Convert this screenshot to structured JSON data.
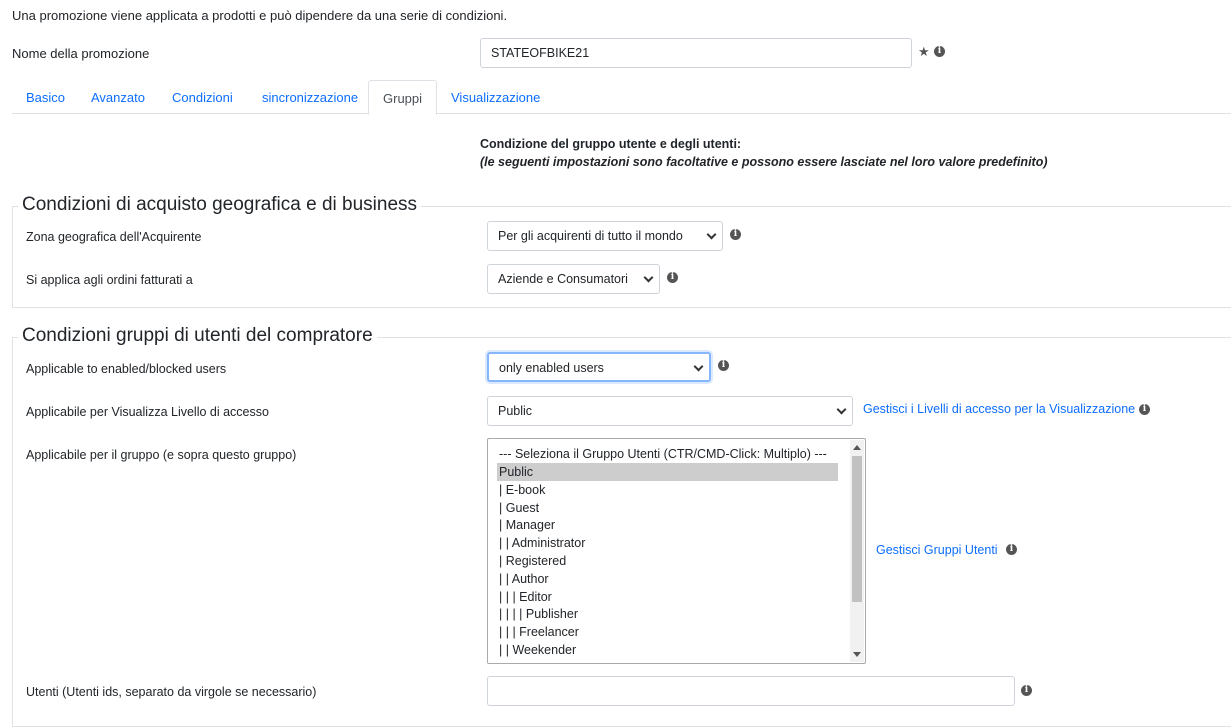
{
  "intro_text": "Una promozione viene applicata a prodotti e può dipendere da una serie di condizioni.",
  "promo_name": {
    "label": "Nome della promozione",
    "value": "STATEOFBIKE21"
  },
  "tabs": [
    {
      "label": "Basico"
    },
    {
      "label": "Avanzato"
    },
    {
      "label": "Condizioni"
    },
    {
      "label": "sincronizzazione"
    },
    {
      "label": "Gruppi"
    },
    {
      "label": "Visualizzazione"
    }
  ],
  "active_tab": "Gruppi",
  "group_heading": {
    "title": "Condizione del gruppo utente e degli utenti:",
    "subtitle": "(le seguenti impostazioni sono facoltative e possono essere lasciate nel loro valore predefinito)"
  },
  "geo_section": {
    "legend": "Condizioni di acquisto geografica e di business",
    "zone_label": "Zona geografica dell'Acquirente",
    "zone_value": "Per gli acquirenti di tutto il mondo",
    "billing_label": "Si applica agli ordini fatturati a",
    "billing_value": "Aziende e Consumatori"
  },
  "user_section": {
    "legend": "Condizioni gruppi di utenti del compratore",
    "enabled_label": "Applicable to enabled/blocked users",
    "enabled_value": "only enabled users",
    "access_label": "Applicabile per Visualizza Livello di accesso",
    "access_value": "Public",
    "access_link": "Gestisci i Livelli di accesso per la Visualizzazione",
    "group_label": "Applicabile per il gruppo (e sopra questo gruppo)",
    "group_options": [
      "--- Seleziona il Gruppo Utenti (CTR/CMD-Click: Multiplo) ---",
      "Public",
      "| E-book",
      "| Guest",
      "| Manager",
      "| | Administrator",
      "| Registered",
      "| | Author",
      "| | | Editor",
      "| | | | Publisher",
      "| | | Freelancer",
      "| | Weekender"
    ],
    "group_selected": "Public",
    "groups_link": "Gestisci Gruppi Utenti",
    "users_label": "Utenti (Utenti ids, separato da virgole se necessario)",
    "users_value": ""
  }
}
